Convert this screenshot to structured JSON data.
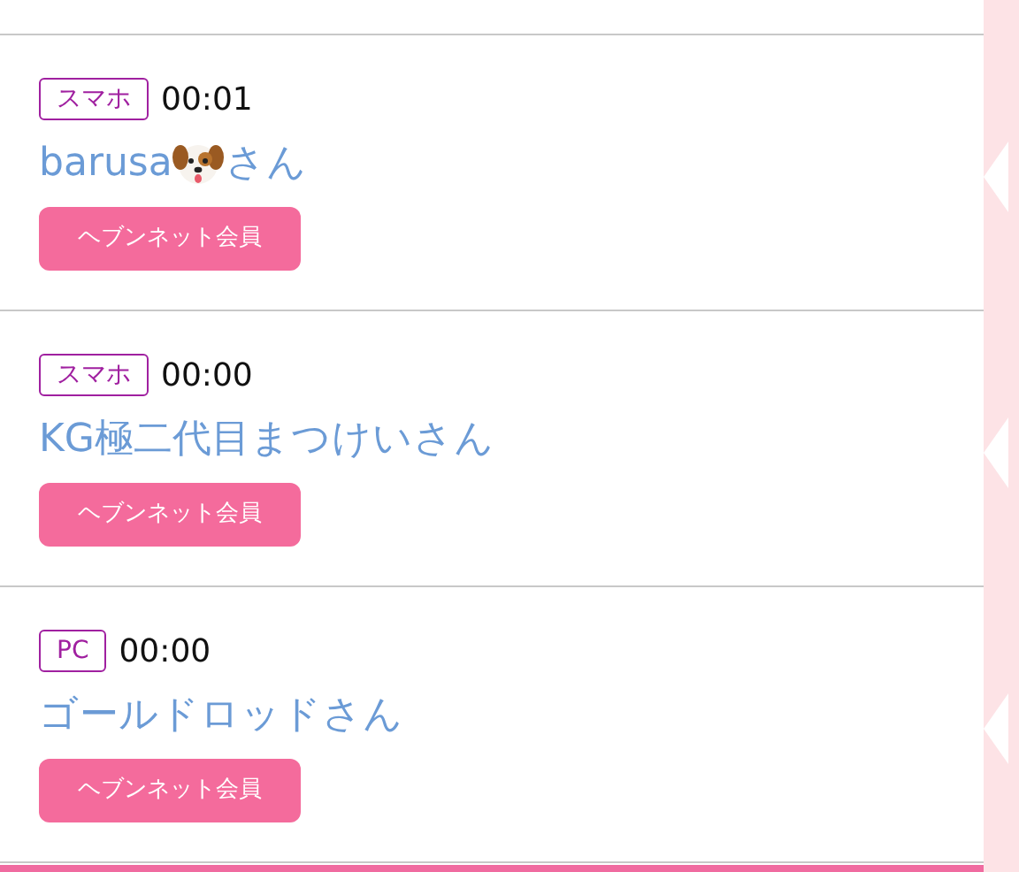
{
  "entries": [
    {
      "device": "スマホ",
      "time": "00:01",
      "name": "barusa",
      "dog_icon": true,
      "suffix": "さん",
      "member": "ヘブンネット会員"
    },
    {
      "device": "スマホ",
      "time": "00:00",
      "name": "KG極二代目まつけい",
      "dog_icon": false,
      "suffix": "さん",
      "member": "ヘブンネット会員"
    },
    {
      "device": "PC",
      "time": "00:00",
      "name": "ゴールドロッド",
      "dog_icon": false,
      "suffix": "さん",
      "member": "ヘブンネット会員"
    }
  ]
}
